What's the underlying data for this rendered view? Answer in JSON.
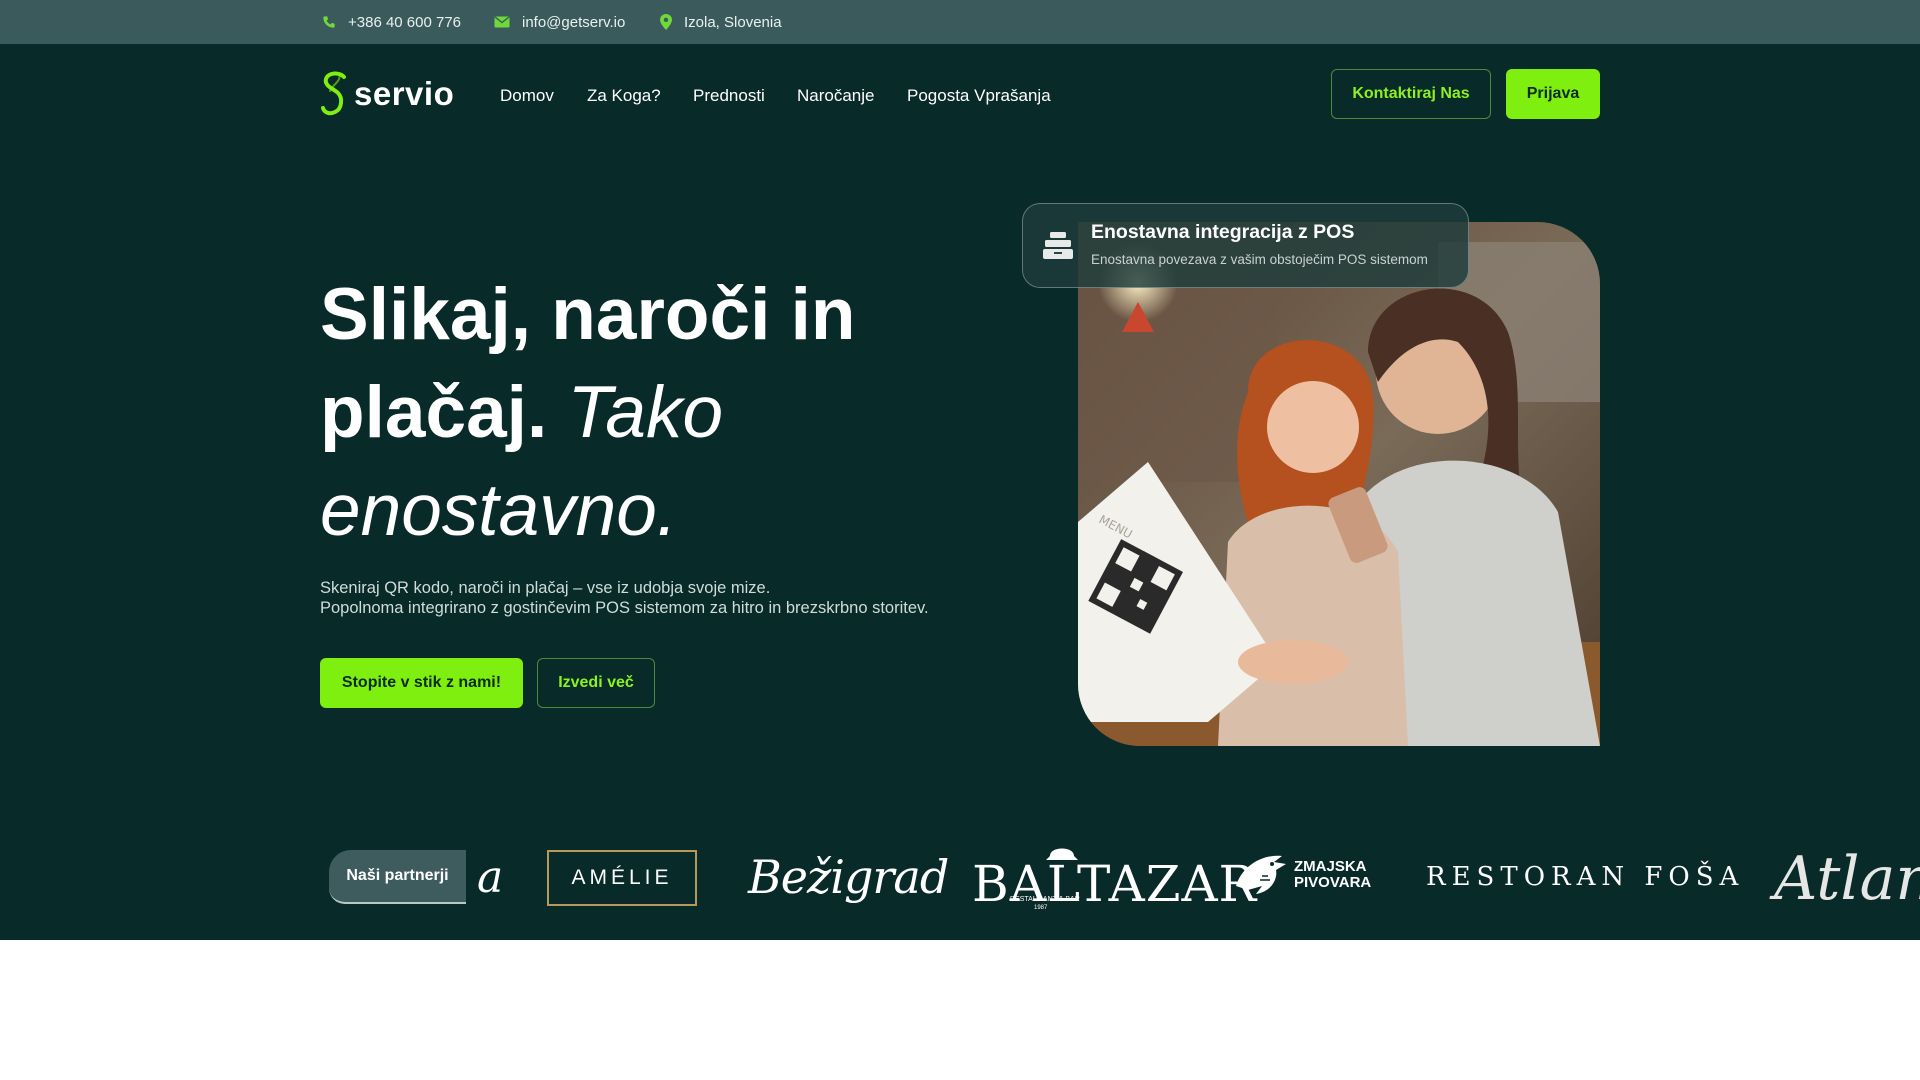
{
  "topbar": {
    "phone": "+386 40 600 776",
    "email": "info@getserv.io",
    "location": "Izola, Slovenia",
    "phone_icon": "phone-icon",
    "email_icon": "mail-icon",
    "location_icon": "map-pin-icon"
  },
  "brand": {
    "name": "servio"
  },
  "nav": {
    "items": [
      "Domov",
      "Za Koga?",
      "Prednosti",
      "Naročanje",
      "Pogosta Vprašanja"
    ]
  },
  "header_buttons": {
    "contact": "Kontaktiraj Nas",
    "login": "Prijava"
  },
  "hero": {
    "title_line1": "Slikaj, naroči in",
    "title_line2_bold": "plačaj.",
    "title_line2_italic": "Tako",
    "title_line3_italic": "enostavno.",
    "subtitle_line1": "Skeniraj QR kodo, naroči in plačaj – vse iz udobja svoje mize.",
    "subtitle_line2": "Popolnoma integrirano z gostinčevim POS sistemom za hitro in brezskrbno storitev.",
    "cta_primary": "Stopite v stik z nami!",
    "cta_secondary": "Izvedi več"
  },
  "callout": {
    "icon": "pos-register-icon",
    "title": "Enostavna integracija z POS",
    "subtitle": "Enostavna povezava z vašim obstoječim POS sistemom"
  },
  "photo": {
    "menu_label": "MENU"
  },
  "partners": {
    "tag": "Naši partnerji",
    "logos": [
      "a",
      "AMÉLIE",
      "Bežigrad",
      "BALTAZAR",
      "RESTAURANT & BAR",
      "1987",
      "ZMAJSKA",
      "PIVOVARA",
      "RESTORAN FOŠA",
      "Atlantic"
    ]
  },
  "colors": {
    "topbar_bg": "#3a5a5b",
    "hero_bg": "#082a28",
    "accent": "#7fef0f",
    "accent_text": "#8df021"
  }
}
